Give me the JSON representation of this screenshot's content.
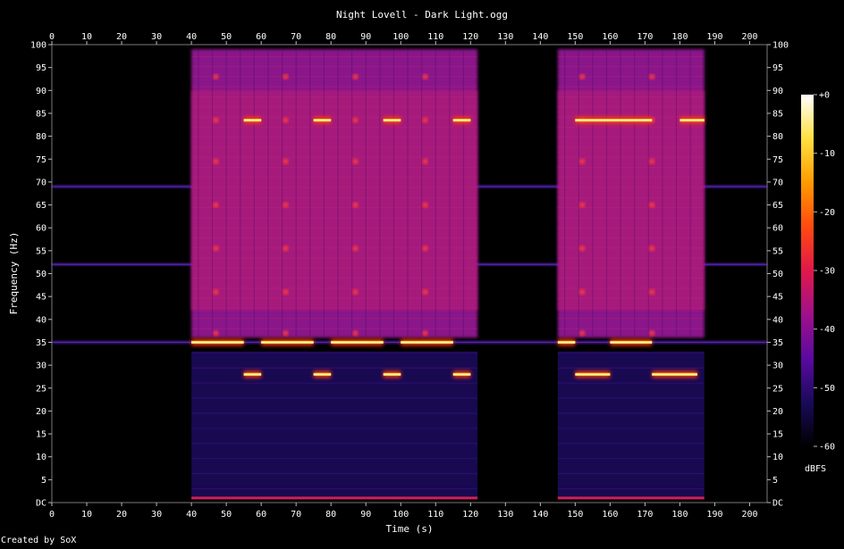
{
  "chart_data": {
    "type": "heatmap",
    "title": "Night Lovell - Dark Light.ogg",
    "xlabel": "Time (s)",
    "ylabel": "Frequency (Hz)",
    "xlim": [
      0,
      205
    ],
    "ylim": [
      0,
      100
    ],
    "x_ticks": [
      "0",
      "10",
      "20",
      "30",
      "40",
      "50",
      "60",
      "70",
      "80",
      "90",
      "100",
      "110",
      "120",
      "130",
      "140",
      "150",
      "160",
      "170",
      "180",
      "190",
      "200"
    ],
    "y_ticks": [
      "DC",
      "5",
      "10",
      "15",
      "20",
      "25",
      "30",
      "35",
      "40",
      "45",
      "50",
      "55",
      "60",
      "65",
      "70",
      "75",
      "80",
      "85",
      "90",
      "95",
      "100"
    ],
    "colorbar": {
      "label": "dBFS",
      "ticks": [
        "+0",
        "-10",
        "-20",
        "-30",
        "-40",
        "-50",
        "-60"
      ],
      "range": [
        -60,
        0
      ],
      "colors": [
        "#000000",
        "#1a0a5a",
        "#5a0aa0",
        "#a0108a",
        "#e0184a",
        "#ff4a10",
        "#ff9a00",
        "#ffe040",
        "#ffffff"
      ]
    },
    "footer": "Created by SoX",
    "segments": [
      {
        "start": 40,
        "end": 122,
        "kind": "loud"
      },
      {
        "start": 145,
        "end": 187,
        "kind": "loud"
      }
    ],
    "quiet_tones_hz": [
      69,
      52,
      35
    ],
    "loud_tones": [
      {
        "hz": 35,
        "ranges": [
          [
            40,
            55
          ],
          [
            60,
            75
          ],
          [
            80,
            95
          ],
          [
            100,
            115
          ],
          [
            145,
            150
          ],
          [
            160,
            172
          ]
        ]
      },
      {
        "hz": 28,
        "ranges": [
          [
            55,
            60
          ],
          [
            75,
            80
          ],
          [
            95,
            100
          ],
          [
            115,
            120
          ],
          [
            150,
            160
          ],
          [
            172,
            185
          ]
        ]
      },
      {
        "hz": 83.5,
        "ranges": [
          [
            55,
            60
          ],
          [
            75,
            80
          ],
          [
            95,
            100
          ],
          [
            115,
            120
          ],
          [
            150,
            172
          ],
          [
            180,
            187
          ]
        ]
      }
    ]
  }
}
